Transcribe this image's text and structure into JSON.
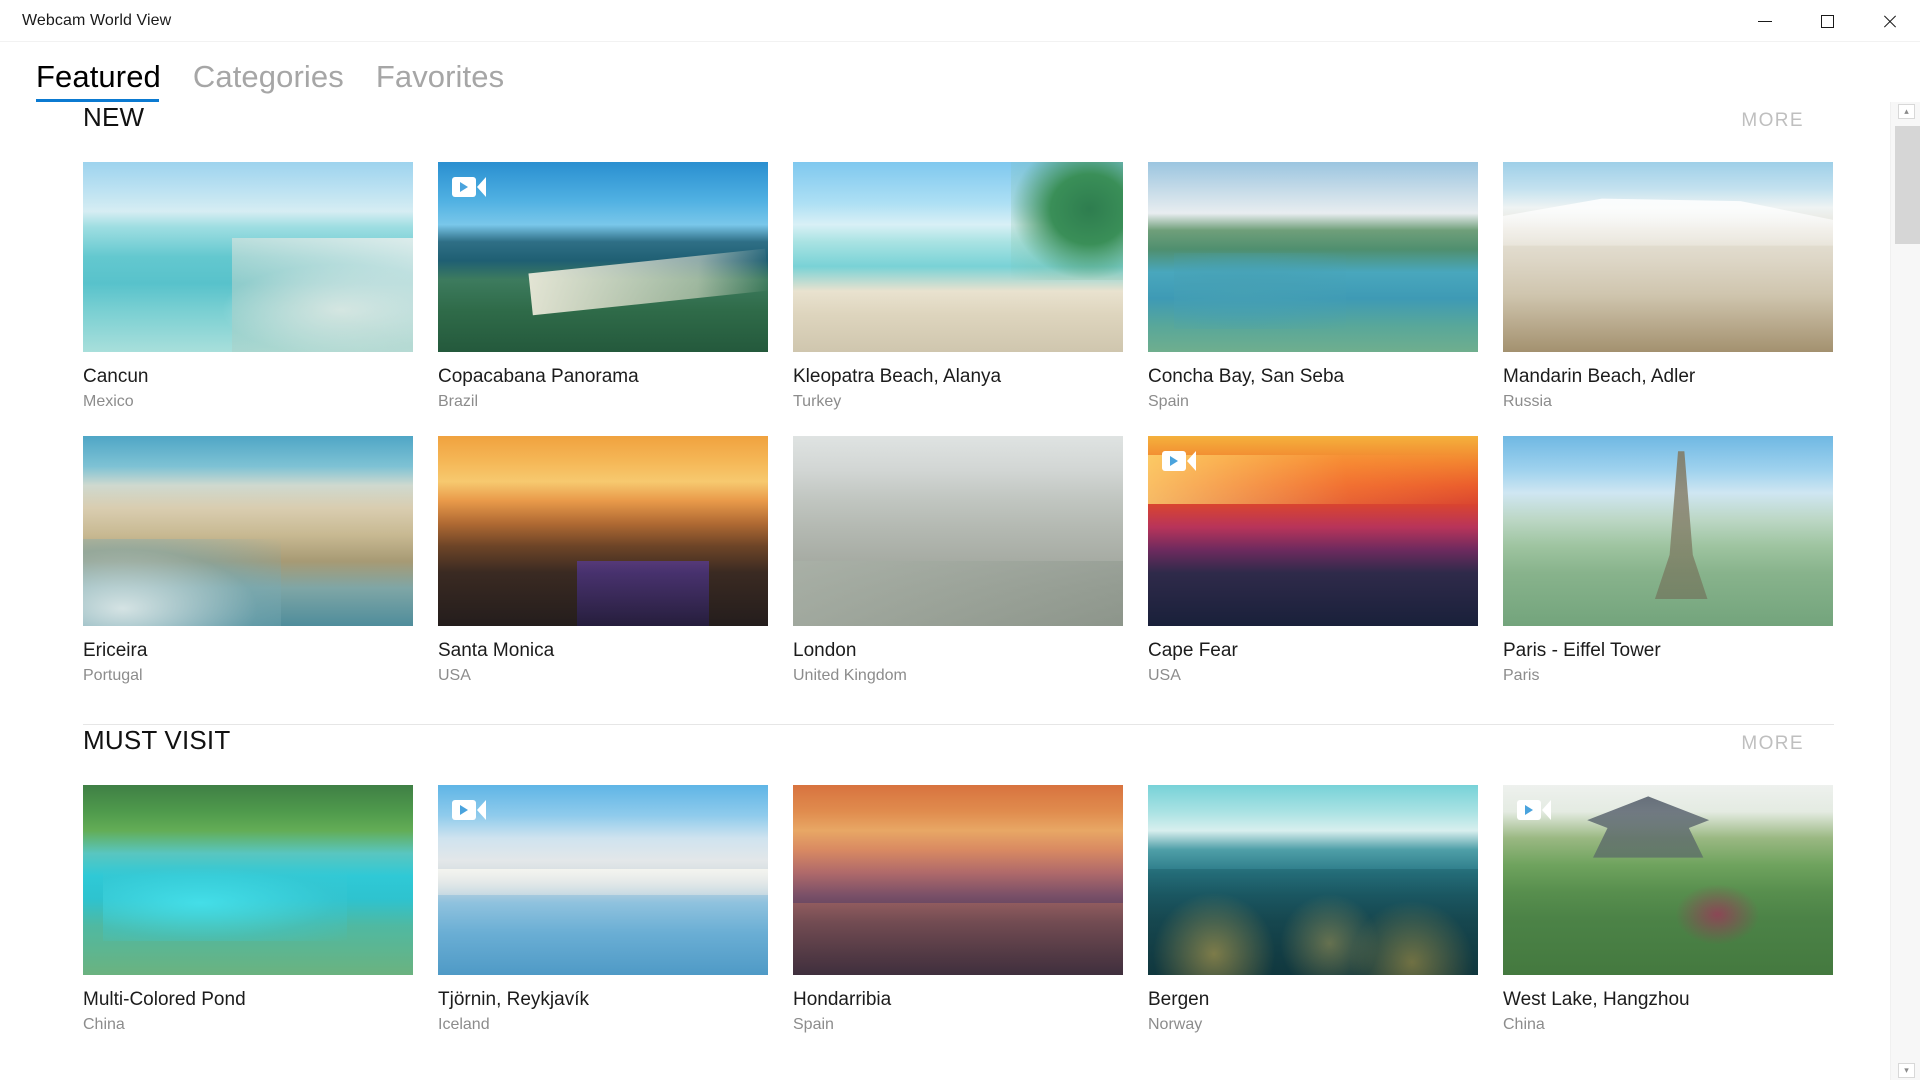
{
  "window": {
    "title": "Webcam World View",
    "controls": {
      "minimize": "minimize",
      "maximize": "maximize",
      "close": "close"
    }
  },
  "tabs": [
    {
      "label": "Featured",
      "active": true
    },
    {
      "label": "Categories",
      "active": false
    },
    {
      "label": "Favorites",
      "active": false
    }
  ],
  "accent_color": "#0b7ad1",
  "sections": [
    {
      "title": "NEW",
      "more_label": "MORE",
      "cards": [
        {
          "title": "Cancun",
          "subtitle": "Mexico",
          "art": "art-cancun",
          "video": false
        },
        {
          "title": "Copacabana Panorama",
          "subtitle": "Brazil",
          "art": "art-copa",
          "video": true
        },
        {
          "title": "Kleopatra Beach, Alanya",
          "subtitle": "Turkey",
          "art": "art-kleo",
          "video": false
        },
        {
          "title": "Concha Bay, San Seba",
          "subtitle": "Spain",
          "art": "art-concha",
          "video": false
        },
        {
          "title": "Mandarin Beach, Adler",
          "subtitle": "Russia",
          "art": "art-mandarin",
          "video": false
        },
        {
          "title": "Ericeira",
          "subtitle": "Portugal",
          "art": "art-ericeira",
          "video": false
        },
        {
          "title": "Santa Monica",
          "subtitle": "USA",
          "art": "art-santamonica",
          "video": false
        },
        {
          "title": "London",
          "subtitle": "United Kingdom",
          "art": "art-london",
          "video": false
        },
        {
          "title": "Cape Fear",
          "subtitle": "USA",
          "art": "art-capefear",
          "video": true
        },
        {
          "title": "Paris - Eiffel Tower",
          "subtitle": "Paris",
          "art": "art-paris",
          "video": false
        }
      ]
    },
    {
      "title": "MUST VISIT",
      "more_label": "MORE",
      "cards": [
        {
          "title": "Multi-Colored Pond",
          "subtitle": "China",
          "art": "art-pond",
          "video": false
        },
        {
          "title": "Tjörnin, Reykjavík",
          "subtitle": "Iceland",
          "art": "art-tjornin",
          "video": true
        },
        {
          "title": "Hondarribia",
          "subtitle": "Spain",
          "art": "art-hondarribia",
          "video": false
        },
        {
          "title": "Bergen",
          "subtitle": "Norway",
          "art": "art-bergen",
          "video": false
        },
        {
          "title": "West Lake, Hangzhou",
          "subtitle": "China",
          "art": "art-westlake",
          "video": true
        }
      ]
    }
  ],
  "scrollbar": {
    "up_arrow": "▴",
    "down_arrow": "▾"
  }
}
